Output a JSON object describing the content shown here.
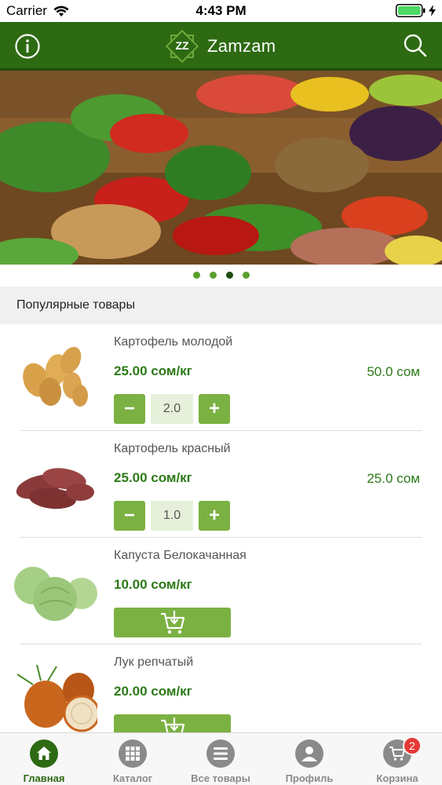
{
  "status_bar": {
    "carrier": "Carrier",
    "time": "4:43 PM"
  },
  "header": {
    "brand": "Zamzam",
    "info_icon": "info-icon",
    "search_icon": "search-icon",
    "color": "#2d6a12"
  },
  "carousel": {
    "page_count": 4,
    "active_page": 3
  },
  "section": {
    "title": "Популярные товары"
  },
  "products": [
    {
      "name": "Картофель молодой",
      "price": "25.00 сом/кг",
      "total": "50.0 сом",
      "qty": "2.0"
    },
    {
      "name": "Картофель красный",
      "price": "25.00 сом/кг",
      "total": "25.0 сом",
      "qty": "1.0"
    },
    {
      "name": "Капуста Белокачанная",
      "price": "10.00 сом/кг"
    },
    {
      "name": "Лук репчатый",
      "price": "20.00 сом/кг"
    }
  ],
  "qty_controls": {
    "minus": "−",
    "plus": "+"
  },
  "tabs": [
    {
      "label": "Главная",
      "icon": "home-icon",
      "active": true
    },
    {
      "label": "Каталог",
      "icon": "grid-icon"
    },
    {
      "label": "Все товары",
      "icon": "list-icon"
    },
    {
      "label": "Профиль",
      "icon": "profile-icon"
    },
    {
      "label": "Корзина",
      "icon": "cart-icon",
      "badge": "2"
    }
  ]
}
